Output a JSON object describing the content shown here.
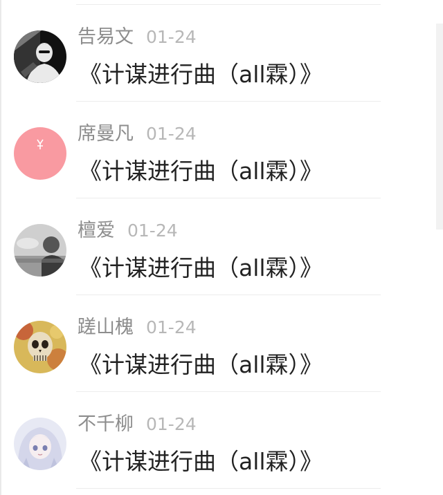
{
  "comments": [
    {
      "name": "告易文",
      "date": "01-24",
      "title": "《计谋进行曲（all霖）》",
      "avatar_icon": "avatar-photo-person-icon"
    },
    {
      "name": "席曼凡",
      "date": "01-24",
      "title": "《计谋进行曲（all霖）》",
      "avatar_icon": "avatar-pink-icon"
    },
    {
      "name": "檀爱",
      "date": "01-24",
      "title": "《计谋进行曲（all霖）》",
      "avatar_icon": "avatar-gray-person-icon"
    },
    {
      "name": "蹉山槐",
      "date": "01-24",
      "title": "《计谋进行曲（all霖）》",
      "avatar_icon": "avatar-skull-icon"
    },
    {
      "name": "不千柳",
      "date": "01-24",
      "title": "《计谋进行曲（all霖）》",
      "avatar_icon": "avatar-anime-girl-icon"
    }
  ],
  "colors": {
    "name": "#8d8d8d",
    "date": "#b7b7b7",
    "title": "#222222",
    "avatar_pink": "#f99aa1"
  }
}
